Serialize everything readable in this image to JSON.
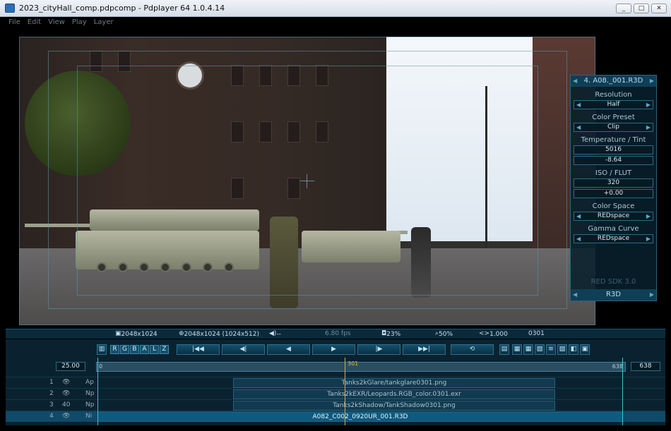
{
  "window": {
    "title": "2023_cityHall_comp.pdpcomp - Pdplayer 64 1.0.4.14",
    "buttons": [
      "_",
      "□",
      "✕"
    ]
  },
  "menu": [
    "File",
    "Edit",
    "View",
    "Play",
    "Layer"
  ],
  "red_panel": {
    "header": "4. A08._001.R3D",
    "resolution_label": "Resolution",
    "resolution_value": "Half",
    "color_preset_label": "Color Preset",
    "color_preset_value": "Clip",
    "temp_tint_label": "Temperature / Tint",
    "temperature": "5016",
    "tint": "-8.64",
    "iso_flut_label": "ISO / FLUT",
    "iso": "320",
    "flut": "+0.00",
    "color_space_label": "Color Space",
    "color_space_value": "REDspace",
    "gamma_label": "Gamma Curve",
    "gamma_value": "REDspace",
    "sdk": "RED SDK 3.0",
    "footer": "R3D"
  },
  "info": {
    "res1": "2048x1024",
    "res2": "2048x1024 (1024x512)",
    "audio": "--",
    "fps": "6.80 fps",
    "percent1": "23%",
    "zoom": "50%",
    "ratio": "1.000",
    "frame": "0301"
  },
  "toolbar": {
    "channels": [
      "R",
      "G",
      "B",
      "A",
      "L",
      "Z"
    ],
    "first": "|◀◀",
    "prev_key": "◀|",
    "prev": "◀",
    "play": "▶",
    "next_key": "|▶",
    "last": "▶▶|"
  },
  "timeline": {
    "fps": "25.00",
    "start": "0",
    "end": "638",
    "end_box": "638",
    "current": "301"
  },
  "layers": [
    {
      "num": "1",
      "eye": "👁",
      "mode": "Ap",
      "name": "Tanks2kGlare/tankglare0301.png"
    },
    {
      "num": "2",
      "eye": "👁",
      "mode": "Np",
      "name": "Tanks2kEXR/Leopards.RGB_color.0301.exr"
    },
    {
      "num": "3",
      "eye": "40",
      "mode": "Np",
      "name": "Tanks2kShadow/TankShadow0301.png"
    },
    {
      "num": "4",
      "eye": "👁",
      "mode": "Ni",
      "name": "A082_C002_0920UR_001.R3D"
    }
  ]
}
